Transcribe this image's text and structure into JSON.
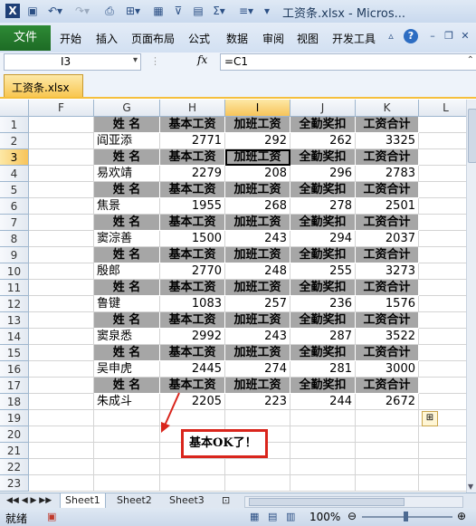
{
  "window": {
    "title": "工资条.xlsx - Micros..."
  },
  "ribbon": {
    "file": "文件",
    "tabs": [
      "开始",
      "插入",
      "页面布局",
      "公式",
      "数据",
      "审阅",
      "视图",
      "开发工具"
    ]
  },
  "formula_bar": {
    "name_box": "I3",
    "fx": "fx",
    "formula": "=C1"
  },
  "workbook_tab": {
    "label": "工资条.xlsx"
  },
  "columns": [
    "F",
    "G",
    "H",
    "I",
    "J",
    "K",
    "L"
  ],
  "rows": [
    "1",
    "2",
    "3",
    "4",
    "5",
    "6",
    "7",
    "8",
    "9",
    "10",
    "11",
    "12",
    "13",
    "14",
    "15",
    "16",
    "17",
    "18",
    "19",
    "20",
    "21",
    "22",
    "23"
  ],
  "header_labels": [
    "姓  名",
    "基本工资",
    "加班工资",
    "全勤奖扣",
    "工资合计"
  ],
  "records": [
    {
      "name": "阎亚添",
      "base": "2771",
      "overtime": "292",
      "attendance": "262",
      "total": "3325"
    },
    {
      "name": "易欢靖",
      "base": "2279",
      "overtime": "208",
      "attendance": "296",
      "total": "2783"
    },
    {
      "name": "焦景",
      "base": "1955",
      "overtime": "268",
      "attendance": "278",
      "total": "2501"
    },
    {
      "name": "窦淙善",
      "base": "1500",
      "overtime": "243",
      "attendance": "294",
      "total": "2037"
    },
    {
      "name": "殷郎",
      "base": "2770",
      "overtime": "248",
      "attendance": "255",
      "total": "3273"
    },
    {
      "name": "鲁键",
      "base": "1083",
      "overtime": "257",
      "attendance": "236",
      "total": "1576"
    },
    {
      "name": "窦泉悉",
      "base": "2992",
      "overtime": "243",
      "attendance": "287",
      "total": "3522"
    },
    {
      "name": "吴申虎",
      "base": "2445",
      "overtime": "274",
      "attendance": "281",
      "total": "3000"
    },
    {
      "name": "朱成斗",
      "base": "2205",
      "overtime": "223",
      "attendance": "244",
      "total": "2672"
    }
  ],
  "sheets": [
    "Sheet1",
    "Sheet2",
    "Sheet3"
  ],
  "status": {
    "ready": "就绪",
    "zoom": "100%"
  },
  "annotation": "基本OK了！",
  "colors": {
    "header_fill": "#a6a6a6",
    "file_tab": "#1d6b25",
    "annotation_border": "#d9251c"
  }
}
